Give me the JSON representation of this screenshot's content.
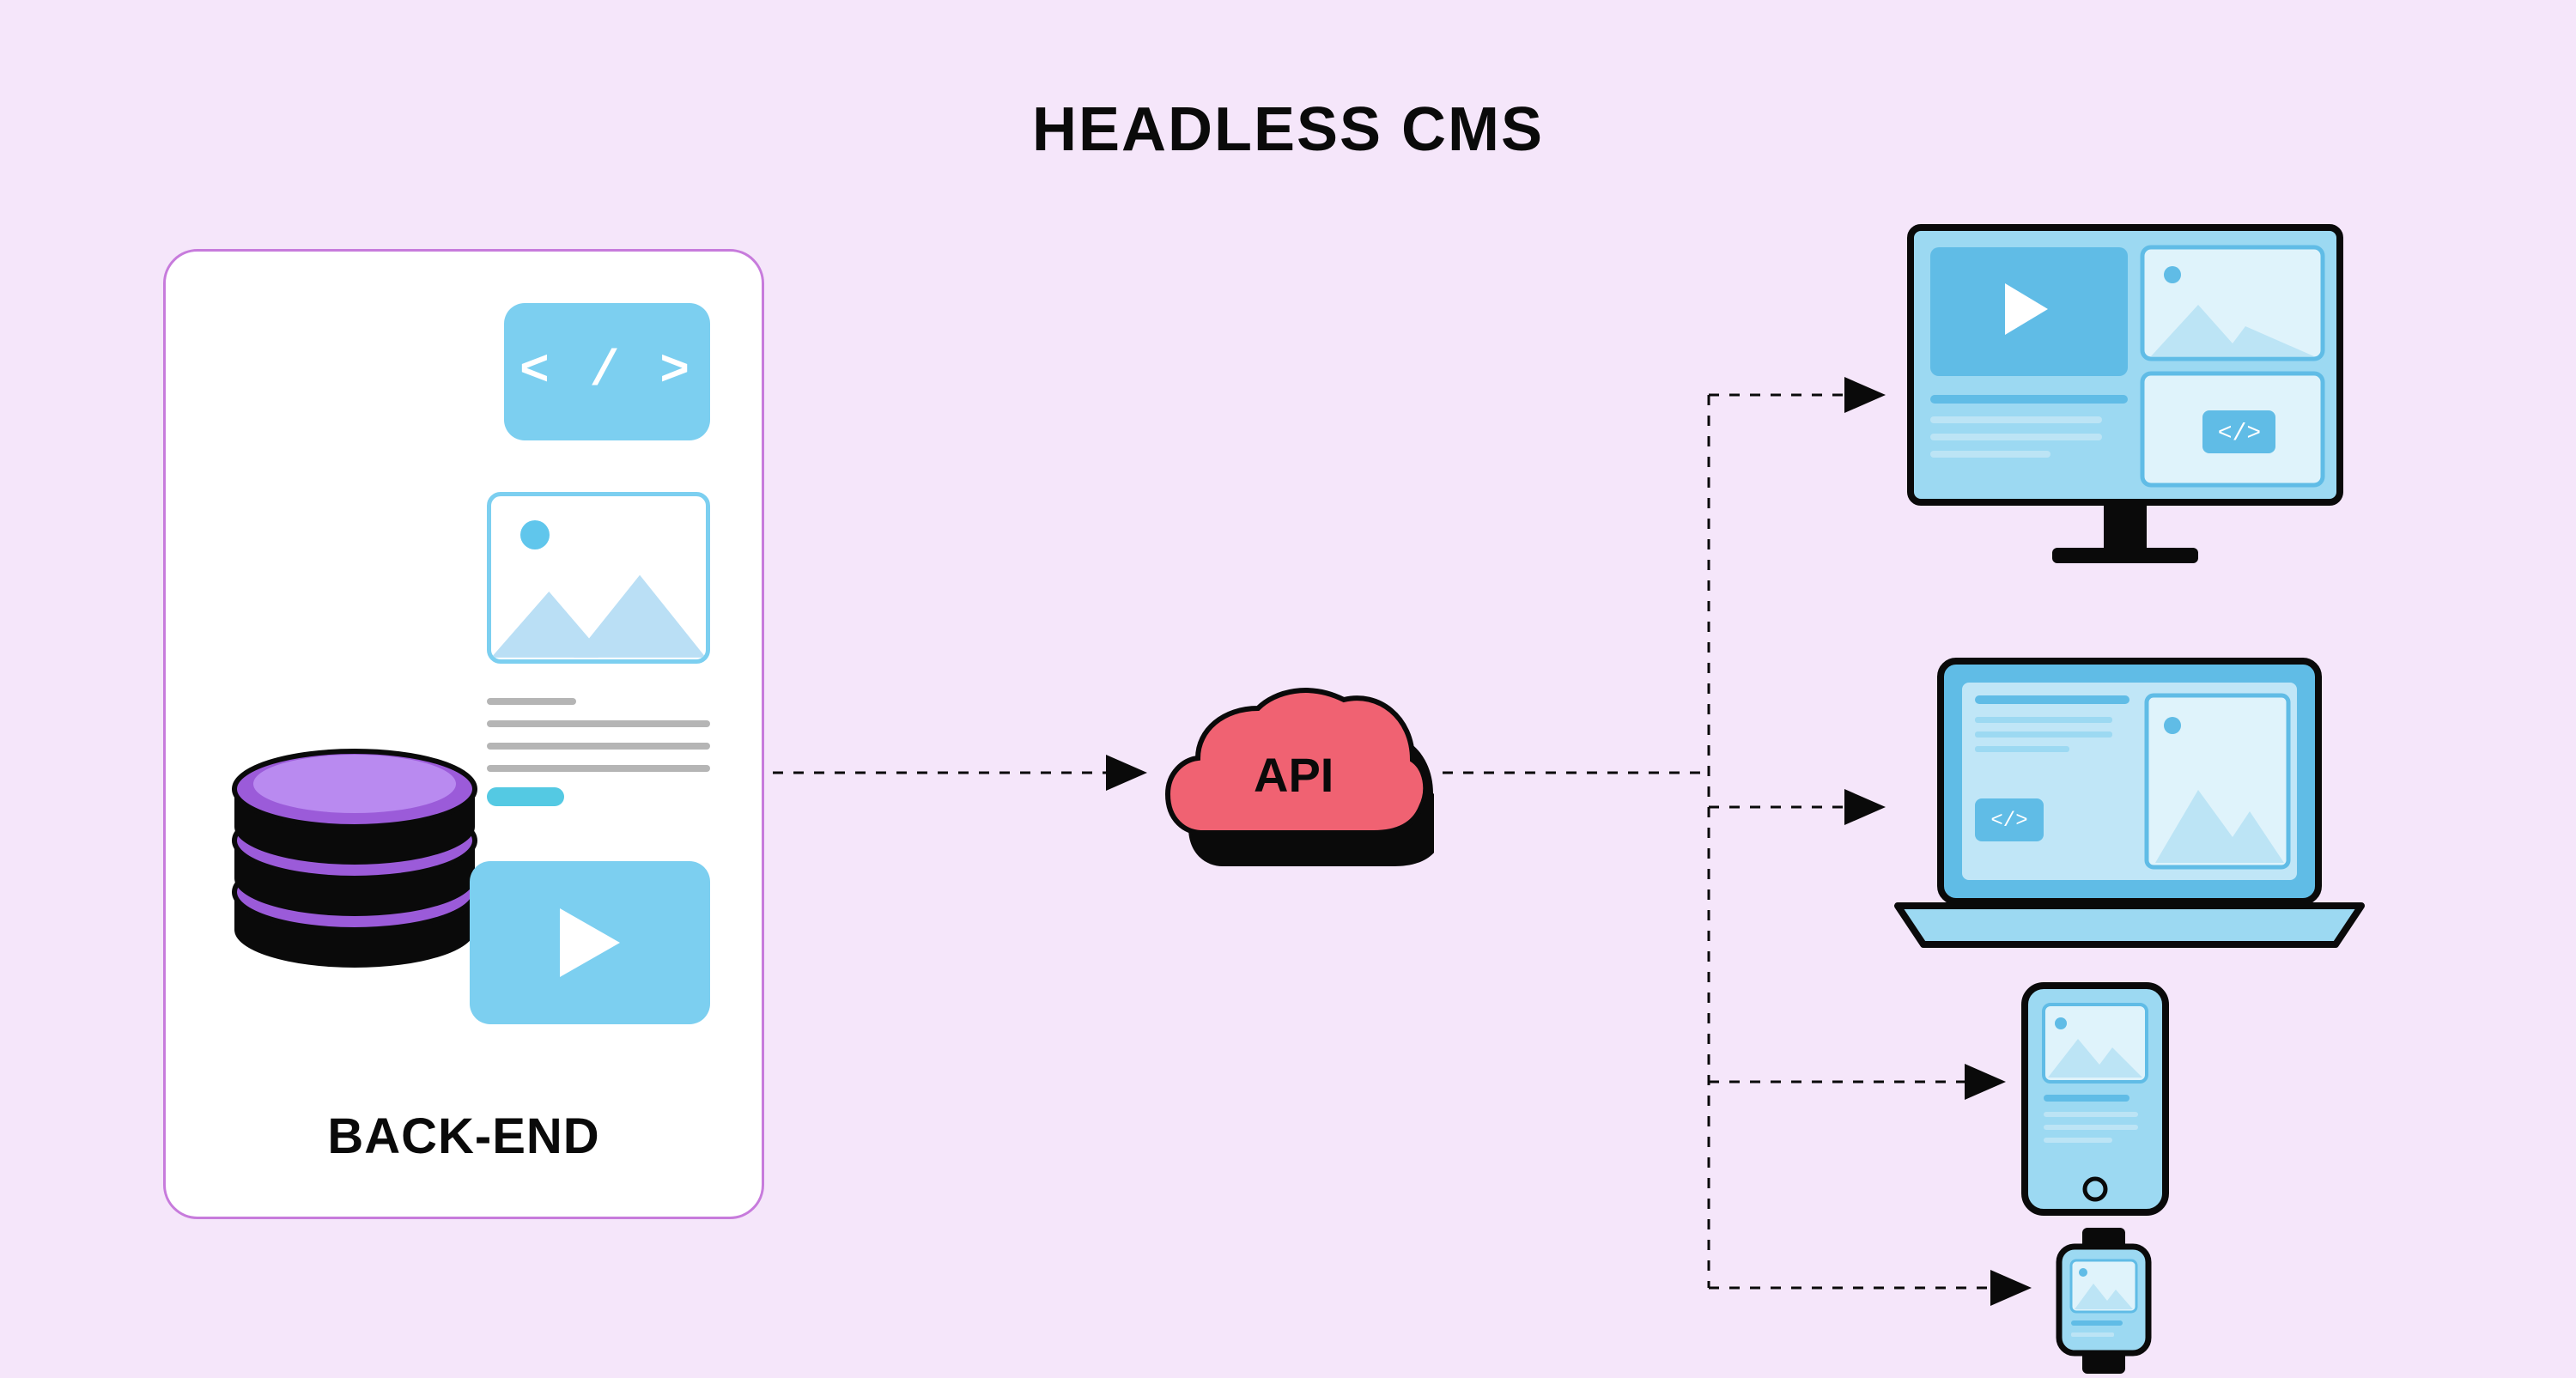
{
  "title": "HEADLESS CMS",
  "backend": {
    "label": "BACK-END",
    "code_glyph": "< / >",
    "content_types": [
      "code",
      "image",
      "text",
      "video"
    ]
  },
  "api": {
    "label": "API"
  },
  "frontends": [
    {
      "name": "desktop",
      "description": "Desktop monitor"
    },
    {
      "name": "laptop",
      "description": "Laptop computer"
    },
    {
      "name": "smartphone",
      "description": "Smartphone"
    },
    {
      "name": "smartwatch",
      "description": "Smartwatch"
    }
  ],
  "arrows": {
    "backend_to_api": true,
    "api_to_frontends": 4
  },
  "colors": {
    "background": "#f5e6fa",
    "panel_border": "#c77bdc",
    "tile_blue": "#7ccff0",
    "cloud_pink": "#f06272",
    "db_purple": "#9b5bd9",
    "text": "#0a0a0a"
  }
}
